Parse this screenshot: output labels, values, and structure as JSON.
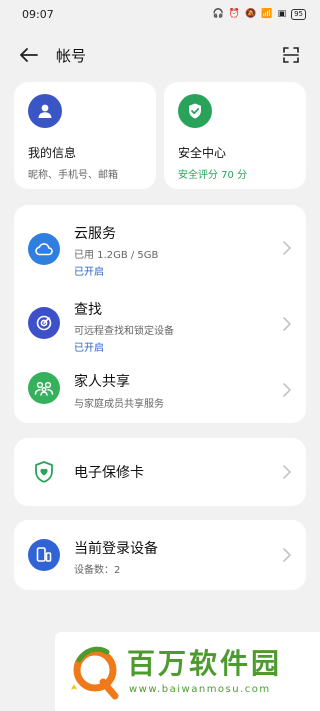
{
  "status_bar": {
    "time": "09:07",
    "battery": "95"
  },
  "header": {
    "title": "帐号"
  },
  "top_cards": [
    {
      "title": "我的信息",
      "subtitle": "昵称、手机号、邮箱",
      "icon": "person-icon",
      "color": "#3a55c4"
    },
    {
      "title": "安全中心",
      "subtitle": "安全评分 70 分",
      "icon": "shield-check-icon",
      "color": "#2aa35a"
    }
  ],
  "services": [
    {
      "title": "云服务",
      "subtitle": "已用 1.2GB / 5GB",
      "status": "已开启",
      "icon": "cloud-icon",
      "color": "#2f7fe0"
    },
    {
      "title": "查找",
      "subtitle": "可远程查找和锁定设备",
      "status": "已开启",
      "icon": "radar-icon",
      "color": "#3d50c8"
    },
    {
      "title": "家人共享",
      "subtitle": "与家庭成员共享服务",
      "icon": "family-icon",
      "color": "#35b05c"
    }
  ],
  "warranty": {
    "title": "电子保修卡",
    "icon": "shield-heart-icon"
  },
  "devices": {
    "title": "当前登录设备",
    "subtitle": "设备数：2",
    "icon": "devices-icon",
    "color": "#2f63d6"
  },
  "watermark": {
    "brand": "百万软件园",
    "url": "www.baiwanmosu.com"
  }
}
